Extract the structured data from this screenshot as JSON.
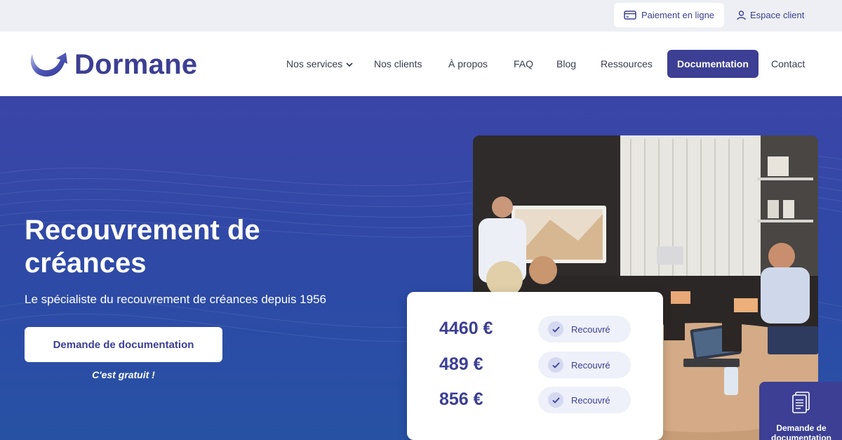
{
  "topbar": {
    "payment_label": "Paiement en ligne",
    "payment_icon": "credit-card-icon",
    "client_label": "Espace client",
    "client_icon": "user-icon"
  },
  "brand": {
    "name": "Dormane",
    "color": "#3c3f93"
  },
  "nav": {
    "items": [
      {
        "label": "Nos services"
      },
      {
        "label": "Nos clients"
      },
      {
        "label": "À propos"
      },
      {
        "label": "FAQ"
      },
      {
        "label": "Blog"
      },
      {
        "label": "Ressources"
      },
      {
        "label": "Documentation"
      },
      {
        "label": "Contact"
      }
    ]
  },
  "hero": {
    "title": "Recouvrement de créances",
    "subtitle": "Le spécialiste du recouvrement de créances depuis 1956",
    "cta_label": "Demande de documentation",
    "cta_note": "C'est gratuit !"
  },
  "stats": [
    {
      "amount": "4460 €",
      "status": "Recouvré"
    },
    {
      "amount": "489 €",
      "status": "Recouvré"
    },
    {
      "amount": "856 €",
      "status": "Recouvré"
    }
  ],
  "floating_button": {
    "label": "Demande de documentation",
    "icon": "document-icon"
  }
}
